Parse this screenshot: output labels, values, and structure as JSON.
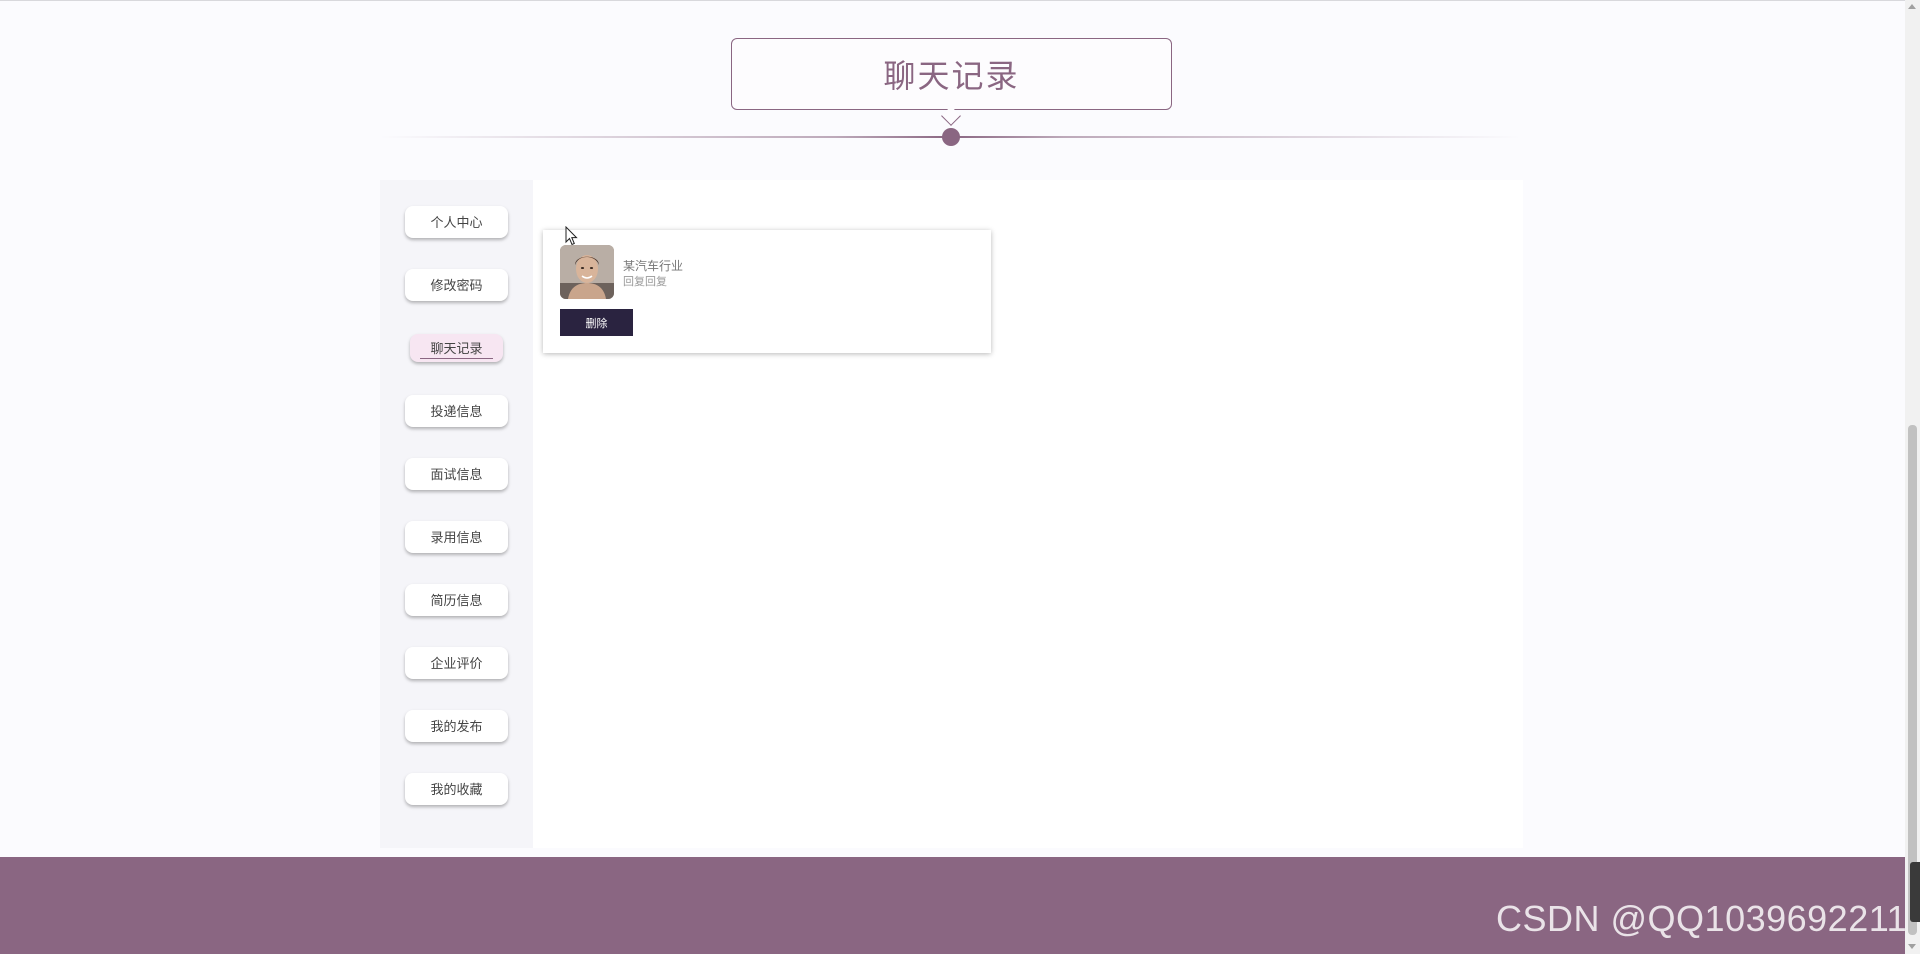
{
  "page": {
    "title": "聊天记录"
  },
  "sidebar": {
    "items": [
      {
        "label": "个人中心",
        "active": false
      },
      {
        "label": "修改密码",
        "active": false
      },
      {
        "label": "聊天记录",
        "active": true
      },
      {
        "label": "投递信息",
        "active": false
      },
      {
        "label": "面试信息",
        "active": false
      },
      {
        "label": "录用信息",
        "active": false
      },
      {
        "label": "简历信息",
        "active": false
      },
      {
        "label": "企业评价",
        "active": false
      },
      {
        "label": "我的发布",
        "active": false
      },
      {
        "label": "我的收藏",
        "active": false
      }
    ]
  },
  "chat": {
    "messages": [
      {
        "name": "某汽车行业",
        "text": "回复回复",
        "delete_label": "删除",
        "avatar_icon": "person-avatar"
      }
    ]
  },
  "footer": {
    "watermark": "CSDN @QQ1039692211"
  },
  "colors": {
    "accent": "#8a6682",
    "button_dark": "#2a2340",
    "active_item_bg": "#f7e6f2"
  }
}
